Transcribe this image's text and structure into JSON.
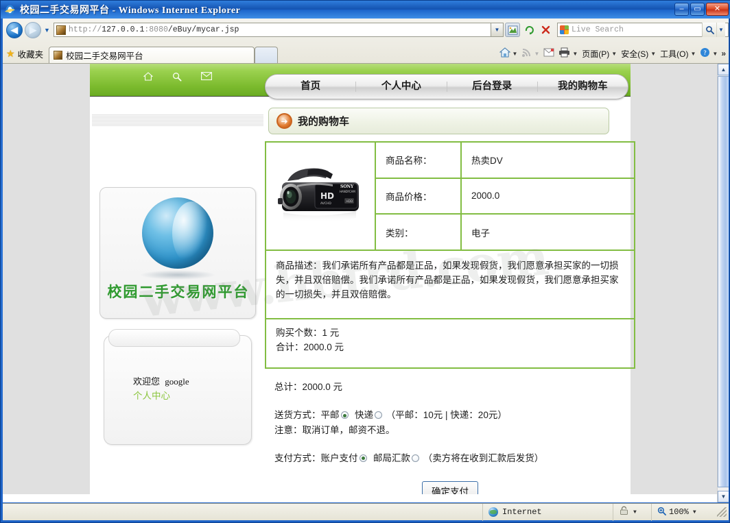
{
  "window": {
    "title": "校园二手交易网平台 - Windows Internet Explorer",
    "minimize_label": "–",
    "maximize_label": "▭",
    "close_label": "✕"
  },
  "toolbar": {
    "back_label": "◀",
    "forward_label": "▶",
    "history_caret": "▼",
    "address_scheme": "http://",
    "address_host": "127.0.0.1",
    "address_port": ":8080",
    "address_path": "/eBuy/mycar.jsp",
    "address_full": "http://127.0.0.1:8080/eBuy/mycar.jsp",
    "address_caret": "▼",
    "compat_label": "⛰",
    "refresh_label": "↻",
    "stop_label": "✕",
    "search_placeholder": "Live Search",
    "search_go_label": "🔍",
    "search_caret": "▼"
  },
  "favorites": {
    "star": "★",
    "label": "收藏夹"
  },
  "tabs": [
    {
      "title": "校园二手交易网平台",
      "active": true
    }
  ],
  "commands": [
    {
      "icon": "🏠",
      "label": "",
      "caret": "▼",
      "name": "home"
    },
    {
      "icon": "📡",
      "label": "",
      "caret": "▼",
      "name": "feeds"
    },
    {
      "icon": "✉",
      "label": "",
      "caret": "",
      "name": "mail"
    },
    {
      "icon": "🖶",
      "label": "",
      "caret": "▼",
      "name": "print"
    },
    {
      "icon": "",
      "label": "页面(P)",
      "caret": "▼",
      "name": "page"
    },
    {
      "icon": "",
      "label": "安全(S)",
      "caret": "▼",
      "name": "safety"
    },
    {
      "icon": "",
      "label": "工具(O)",
      "caret": "▼",
      "name": "tools"
    },
    {
      "icon": "❓",
      "label": "",
      "caret": "▼",
      "name": "help"
    }
  ],
  "commands_overflow": "»",
  "site": {
    "header_icons": [
      {
        "glyph": "⌂",
        "name": "home-icon"
      },
      {
        "glyph": "🔍",
        "name": "search-icon"
      },
      {
        "glyph": "✉",
        "name": "mail-icon"
      }
    ],
    "nav_tabs": [
      {
        "label": "首页"
      },
      {
        "label": "个人中心"
      },
      {
        "label": "后台登录"
      },
      {
        "label": "我的购物车"
      }
    ],
    "logo_text": "校园二手交易网平台",
    "sidebar": {
      "welcome_prefix": "欢迎您",
      "username": "google",
      "link_label": "个人中心"
    },
    "watermark": "www.hbtrd.com"
  },
  "cart": {
    "panel_title": "我的购物车",
    "arrow_icon": "➔",
    "product": {
      "image_alt": "SONY HD 摄像机",
      "rows": [
        {
          "label": "商品名称：",
          "value": "热卖DV"
        },
        {
          "label": "商品价格：",
          "value": "2000.0"
        },
        {
          "label": "类别：",
          "value": "电子"
        }
      ],
      "description_label": "商品描述：",
      "description": "我们承诺所有产品都是正品，如果发现假货，我们愿意承担买家的一切损失，并且双倍赔偿。我们承诺所有产品都是正品，如果发现假货，我们愿意承担买家的一切损失，并且双倍赔偿。",
      "quantity_line": "购买个数：1 元",
      "subtotal_line": "合计：2000.0 元"
    },
    "grand_total_line": "总计：2000.0 元",
    "shipping": {
      "label": "送货方式：",
      "option_standard": "平邮",
      "option_express": "快递",
      "selected": "平邮",
      "price_note": "（平邮：10元 | 快递：20元）",
      "notice": "注意：取消订单，邮资不退。"
    },
    "payment": {
      "label": "支付方式：",
      "option_account": "账户支付",
      "option_remittance": "邮局汇款",
      "selected": "账户支付",
      "note": "（卖方将在收到汇款后发货）"
    },
    "confirm_button": "确定支付"
  },
  "statusbar": {
    "zone": "Internet",
    "zone_caret": "▼",
    "lock_icon": "🔓",
    "zoom_level": "100%",
    "zoom_caret": "▼"
  },
  "colors": {
    "accent_green": "#7cbb2e",
    "border_green": "#82bd42",
    "link_green": "#8cc63f",
    "logo_green": "#2f9a2f",
    "chrome_blue": "#1e63c6",
    "arrow_orange": "#c9641f"
  }
}
